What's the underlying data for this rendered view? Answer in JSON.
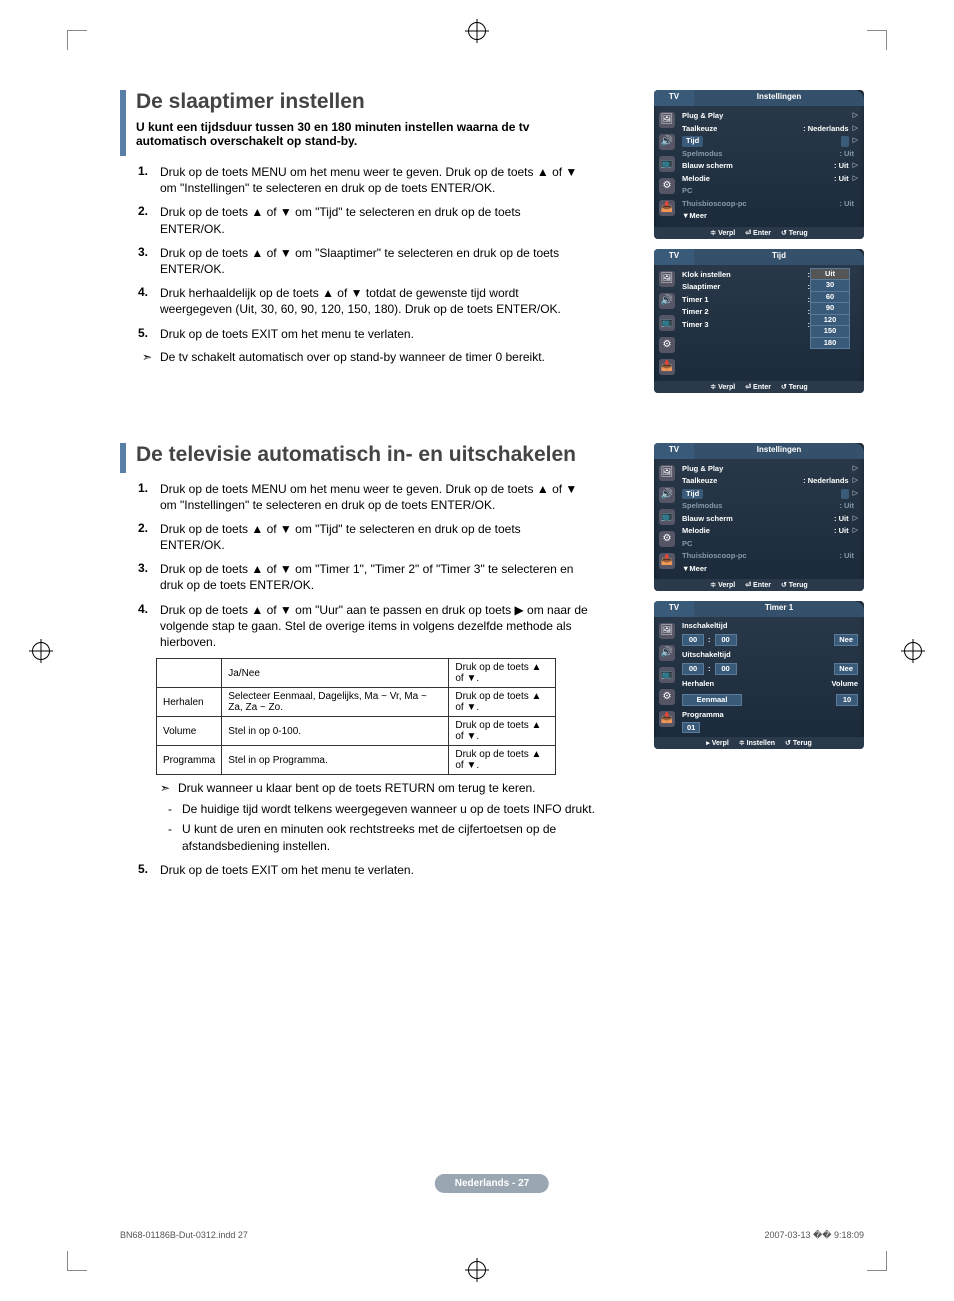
{
  "section1": {
    "title": "De slaaptimer instellen",
    "intro": "U kunt een tijdsduur tussen 30 en 180 minuten instellen waarna de tv automatisch overschakelt op stand-by.",
    "steps": [
      "Druk op de toets MENU om het menu weer te geven. Druk op de toets ▲ of ▼ om \"Instellingen\" te selecteren en druk op de toets ENTER/OK.",
      "Druk op de toets ▲ of ▼ om \"Tijd\" te selecteren en druk op de toets ENTER/OK.",
      "Druk op de toets ▲ of ▼ om \"Slaaptimer\" te selecteren en druk op de toets ENTER/OK.",
      "Druk herhaaldelijk op de toets ▲ of ▼ totdat de gewenste tijd wordt weergegeven (Uit, 30, 60, 90, 120, 150, 180). Druk op de toets ENTER/OK.",
      "Druk op de toets EXIT om het menu te verlaten."
    ],
    "note": "De tv schakelt automatisch over op stand-by wanneer de timer 0 bereikt."
  },
  "osd1": {
    "tv": "TV",
    "title": "Instellingen",
    "rows": [
      {
        "label": "Plug & Play",
        "value": "",
        "arrow": "▷"
      },
      {
        "label": "Taalkeuze",
        "value": ": Nederlands",
        "arrow": "▷"
      },
      {
        "label": "Tijd",
        "value": "",
        "hl": true,
        "arrow": "▷"
      },
      {
        "label": "Spelmodus",
        "value": ": Uit",
        "dim": true
      },
      {
        "label": "Blauw scherm",
        "value": ": Uit",
        "arrow": "▷"
      },
      {
        "label": "Melodie",
        "value": ": Uit",
        "arrow": "▷"
      },
      {
        "label": "PC",
        "value": "",
        "dim": true
      },
      {
        "label": "Thuisbioscoop-pc",
        "value": ": Uit",
        "dim": true
      },
      {
        "label": "▼Meer",
        "value": ""
      }
    ],
    "footer": {
      "move": "Verpl",
      "enter": "Enter",
      "return": "Terug"
    }
  },
  "osd2": {
    "tv": "TV",
    "title": "Tijd",
    "rows": [
      {
        "label": "Klok instellen",
        "value": ":"
      },
      {
        "label": "Slaaptimer",
        "value": ":"
      },
      {
        "label": "Timer 1",
        "value": ":"
      },
      {
        "label": "Timer 2",
        "value": ":"
      },
      {
        "label": "Timer 3",
        "value": ":"
      }
    ],
    "options": [
      "Uit",
      "30",
      "60",
      "90",
      "120",
      "150",
      "180"
    ],
    "footer": {
      "move": "Verpl",
      "enter": "Enter",
      "return": "Terug"
    }
  },
  "section2": {
    "title": "De televisie automatisch in- en uitschakelen",
    "steps": [
      "Druk op de toets MENU om het menu weer te geven. Druk op de toets ▲ of ▼ om \"Instellingen\" te selecteren en druk op de toets ENTER/OK.",
      "Druk op de toets ▲ of ▼ om \"Tijd\" te selecteren en druk op de toets ENTER/OK.",
      "Druk op de toets ▲ of ▼ om \"Timer 1\", \"Timer 2\" of \"Timer 3\" te selecteren en druk op de toets ENTER/OK.",
      "Druk op de toets ▲ of ▼ om \"Uur\" aan te passen en druk op toets ▶ om naar de volgende stap te gaan. Stel de overige items in volgens dezelfde methode als hierboven."
    ],
    "table": {
      "headers": [
        "",
        "Ja/Nee",
        ""
      ],
      "rows": [
        [
          "Herhalen",
          "Selecteer Eenmaal, Dagelijks, Ma ~ Vr, Ma ~ Za, Za ~ Zo.",
          "Druk op de toets ▲ of ▼."
        ],
        [
          "Volume",
          "Stel in op 0-100.",
          "Druk op de toets ▲ of ▼."
        ],
        [
          "Programma",
          "Stel in op Programma.",
          "Druk op de toets ▲ of ▼."
        ]
      ],
      "header_action": "Druk op de toets ▲ of ▼."
    },
    "note": "Druk wanneer u klaar bent op de toets RETURN om terug te keren.",
    "subnotes": [
      "De huidige tijd wordt telkens weergegeven wanneer u op de toets INFO drukt.",
      "U kunt de uren en minuten ook rechtstreeks met de cijfertoetsen op de afstandsbediening instellen."
    ],
    "step5": "Druk op de toets EXIT om het menu te verlaten."
  },
  "osd3": {
    "tv": "TV",
    "title": "Instellingen"
  },
  "osd4": {
    "tv": "TV",
    "title": "Timer 1",
    "on_label": "Inschakeltijd",
    "off_label": "Uitschakeltijd",
    "hour1": "00",
    "min1": "00",
    "act1": "Nee",
    "hour2": "00",
    "min2": "00",
    "act2": "Nee",
    "repeat_label": "Herhalen",
    "volume_label": "Volume",
    "repeat_val": "Eenmaal",
    "volume_val": "10",
    "prog_label": "Programma",
    "prog_val": "01",
    "footer": {
      "move": "Verpl",
      "adjust": "Instellen",
      "return": "Terug"
    }
  },
  "page_badge": "Nederlands - 27",
  "footer": {
    "left": "BN68-01186B-Dut-0312.indd   27",
    "right": "2007-03-13   �� 9:18:09"
  }
}
